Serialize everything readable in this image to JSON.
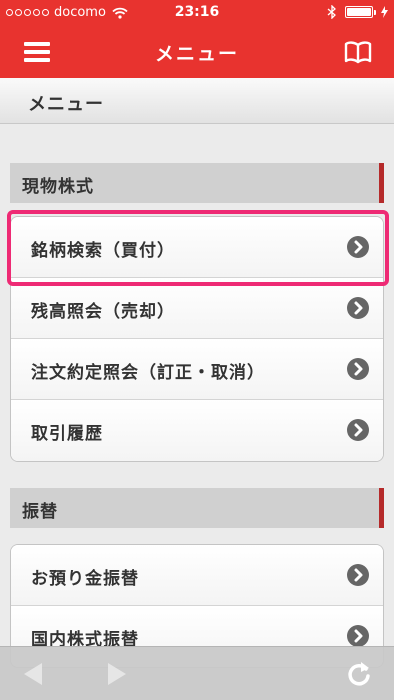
{
  "status_bar": {
    "carrier": "docomo",
    "time": "23:16",
    "battery_level": 1.0
  },
  "nav": {
    "title": "メニュー",
    "menu_icon": "hamburger-icon",
    "book_icon": "book-icon"
  },
  "page_header": {
    "title": "メニュー"
  },
  "sections": [
    {
      "label": "現物株式",
      "items": [
        {
          "label": "銘柄検索（買付）"
        },
        {
          "label": "残高照会（売却）"
        },
        {
          "label": "注文約定照会（訂正・取消）"
        },
        {
          "label": "取引履歴"
        }
      ]
    },
    {
      "label": "振替",
      "items": [
        {
          "label": "お預り金振替"
        },
        {
          "label": "国内株式振替"
        }
      ]
    }
  ],
  "toolbar": {
    "back_icon": "back-arrow-icon",
    "forward_icon": "forward-arrow-icon",
    "reload_icon": "reload-icon"
  },
  "colors": {
    "brand_red": "#e8332f",
    "section_accent": "#b52a2a",
    "highlight": "#ee2a74"
  }
}
